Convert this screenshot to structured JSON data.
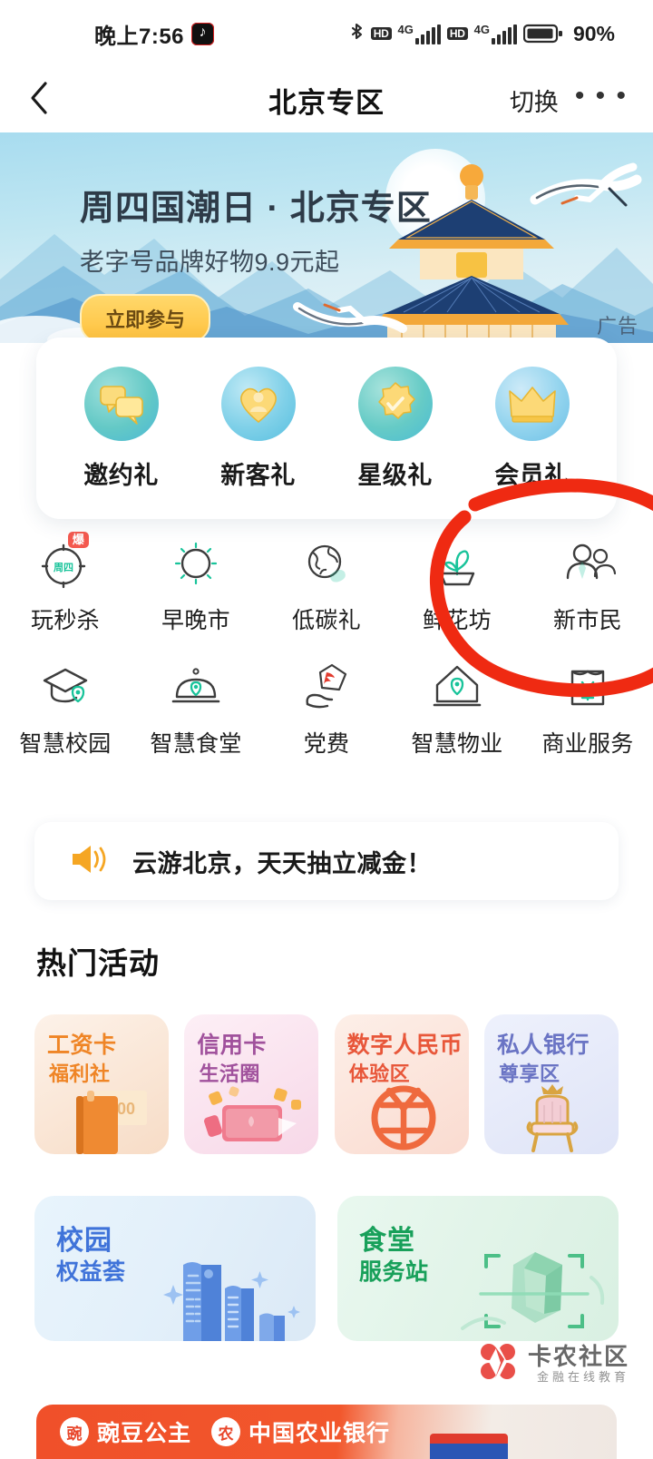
{
  "status_bar": {
    "time": "晚上7:56",
    "app_icon": "tiktok-icon",
    "icons": [
      "bluetooth-icon",
      "hd-icon",
      "4g-signal-icon",
      "hd-icon",
      "4g-signal-icon",
      "battery-icon"
    ],
    "network_label": "4G",
    "hd_label": "HD",
    "battery_percent": "90%"
  },
  "header": {
    "back_icon": "chevron-left-icon",
    "title": "北京专区",
    "switch_label": "切换",
    "more_icon": "ellipsis-icon"
  },
  "banner": {
    "title": "周四国潮日 · 北京专区",
    "subtitle": "老字号品牌好物9.9元起",
    "cta_label": "立即参与",
    "ad_label": "广告"
  },
  "gift_card": {
    "items": [
      {
        "label": "邀约礼",
        "icon": "chat-bubbles-icon"
      },
      {
        "label": "新客礼",
        "icon": "heart-person-icon"
      },
      {
        "label": "星级礼",
        "icon": "star-check-icon"
      },
      {
        "label": "会员礼",
        "icon": "crown-icon"
      }
    ]
  },
  "service_grid": {
    "rows": [
      [
        {
          "label": "玩秒杀",
          "icon": "clock-thursday-icon",
          "badge": "爆",
          "inner_text": "周四"
        },
        {
          "label": "早晚市",
          "icon": "sun-moon-icon"
        },
        {
          "label": "低碳礼",
          "icon": "globe-leaf-icon"
        },
        {
          "label": "鲜花坊",
          "icon": "flower-pot-icon"
        },
        {
          "label": "新市民",
          "icon": "two-people-icon"
        }
      ],
      [
        {
          "label": "智慧校园",
          "icon": "graduation-cap-icon"
        },
        {
          "label": "智慧食堂",
          "icon": "food-cloche-icon"
        },
        {
          "label": "党费",
          "icon": "hand-party-emblem-icon"
        },
        {
          "label": "智慧物业",
          "icon": "house-icon"
        },
        {
          "label": "商业服务",
          "icon": "clipboard-yuan-icon"
        }
      ]
    ]
  },
  "notice": {
    "icon": "speaker-icon",
    "text": "云游北京，天天抽立减金！"
  },
  "hot_section": {
    "title": "热门活动",
    "cards": [
      {
        "line1": "工资卡",
        "line2": "福利社",
        "color": "#f0822a",
        "bg_from": "#fdf0e6",
        "bg_to": "#f8ddc9",
        "art": "book-money-icon"
      },
      {
        "line1": "信用卡",
        "line2": "生活圈",
        "color": "#a0519c",
        "bg_from": "#fceef4",
        "bg_to": "#f9dce9",
        "art": "gift-card-icon"
      },
      {
        "line1": "数字人民币",
        "line2": "体验区",
        "color": "#e8573a",
        "bg_from": "#fdeee7",
        "bg_to": "#fbdfd4",
        "art": "rmb-symbol-icon"
      },
      {
        "line1": "私人银行",
        "line2": "尊享区",
        "color": "#6a74c4",
        "bg_from": "#eef0fb",
        "bg_to": "#e2e6f8",
        "art": "throne-icon"
      }
    ],
    "wide_cards": [
      {
        "line1": "校园",
        "line2": "权益荟",
        "color": "#3f73d9",
        "bg_from": "#e9f4fb",
        "bg_to": "#dcecf8",
        "art": "receipts-icon"
      },
      {
        "line1": "食堂",
        "line2": "服务站",
        "color": "#18a05a",
        "bg_from": "#eaf8ef",
        "bg_to": "#dcf2e5",
        "art": "scan-food-icon"
      }
    ]
  },
  "watermark": {
    "name": "卡农社区",
    "tagline": "金融在线教育",
    "logo_icon": "flower-logo-icon"
  },
  "bottom_ad": {
    "brand1": "豌豆公主",
    "brand2": "中国农业银行"
  },
  "annotation": {
    "type": "hand-drawn-circle",
    "color": "#ef2a12",
    "targets": "新市民"
  }
}
